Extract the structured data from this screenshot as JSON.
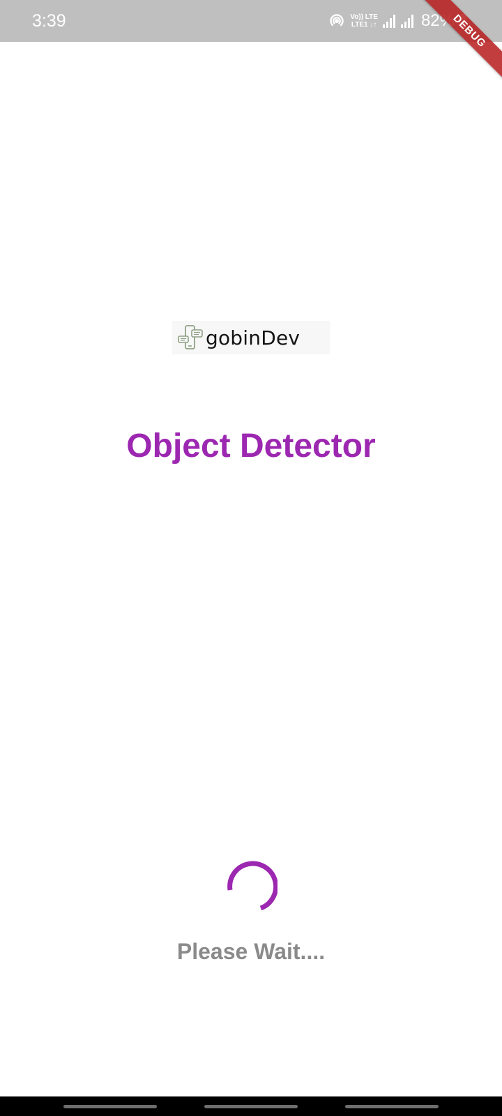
{
  "status_bar": {
    "time": "3:39",
    "network_line1": "Vo)) LTE",
    "network_line2": "LTE1 ↓↑",
    "battery": "82%"
  },
  "debug_banner": {
    "label": "DEBUG",
    "color": "#b71c1c"
  },
  "logo": {
    "text": "gobinDev",
    "icon": "phone-chat-logo-icon"
  },
  "title": "Object Detector",
  "loading": {
    "message": "Please Wait...."
  },
  "colors": {
    "accent": "#9c27b0",
    "status_bar": "#bfbfbf",
    "muted_text": "#8a8a8a"
  }
}
